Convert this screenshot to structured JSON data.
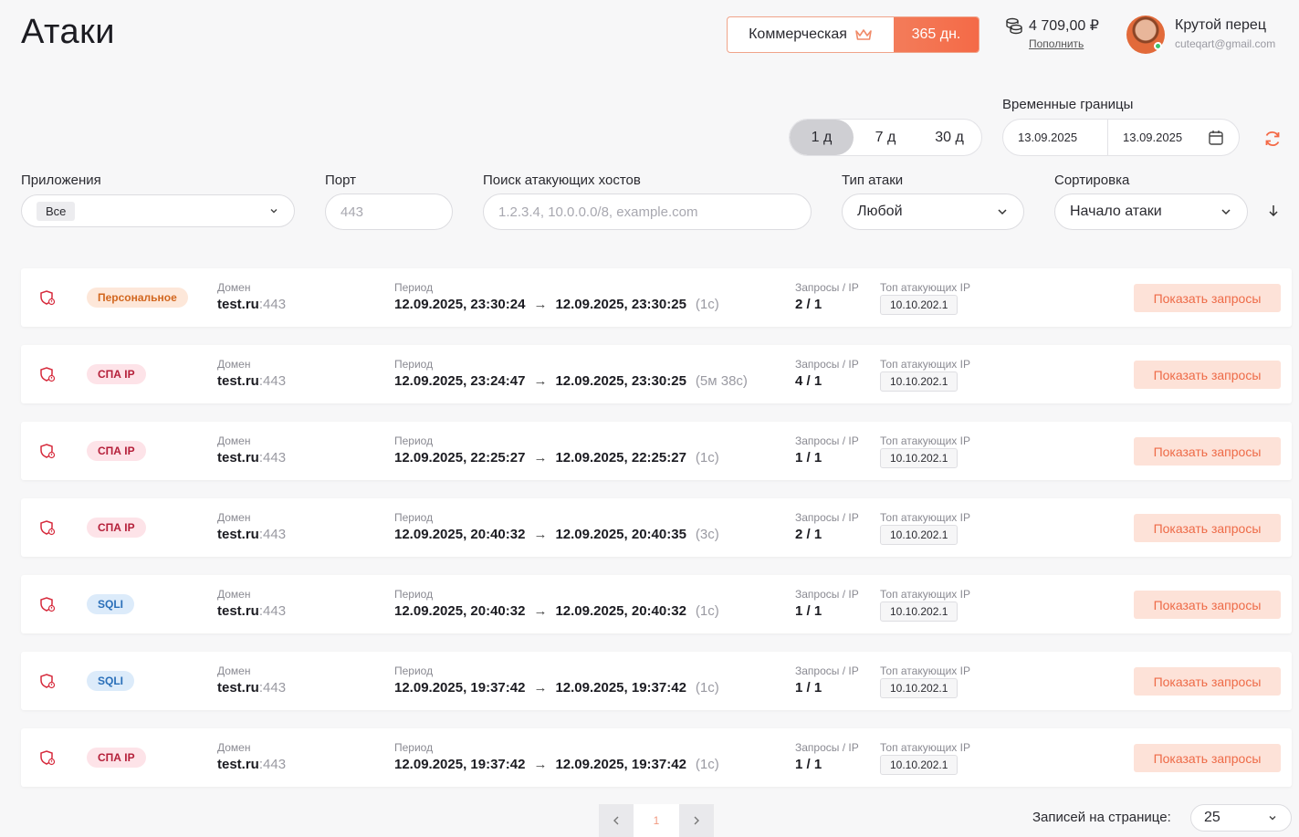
{
  "header": {
    "title": "Атаки",
    "plan_name": "Коммерческая",
    "plan_days": "365 дн.",
    "balance": "4 709,00 ₽",
    "topup_label": "Пополнить",
    "user_name": "Крутой перец",
    "user_email": "cuteqart@gmail.com"
  },
  "time_filter": {
    "label": "Временные границы",
    "periods": [
      "1 д",
      "7 д",
      "30 д"
    ],
    "active_period": "1 д",
    "date_from": "13.09.2025",
    "date_to": "13.09.2025"
  },
  "filters": {
    "apps_label": "Приложения",
    "apps_value": "Все",
    "port_label": "Порт",
    "port_placeholder": "443",
    "search_label": "Поиск атакующих хостов",
    "search_placeholder": "1.2.3.4, 10.0.0.0/8, example.com",
    "attack_type_label": "Тип атаки",
    "attack_type_value": "Любой",
    "sort_label": "Сортировка",
    "sort_value": "Начало атаки"
  },
  "columns": {
    "domain": "Домен",
    "period": "Период",
    "requests_ip": "Запросы / IP",
    "top_ip": "Топ атакующих IP",
    "show_button": "Показать запросы"
  },
  "attacks": [
    {
      "type": "Персональное",
      "type_class": "personal",
      "domain": "test.ru",
      "port": ":443",
      "start": "12.09.2025, 23:30:24",
      "end": "12.09.2025, 23:30:25",
      "duration": "(1с)",
      "requests_ip": "2 / 1",
      "top_ip": "10.10.202.1"
    },
    {
      "type": "СПА IP",
      "type_class": "spa",
      "domain": "test.ru",
      "port": ":443",
      "start": "12.09.2025, 23:24:47",
      "end": "12.09.2025, 23:30:25",
      "duration": "(5м 38с)",
      "requests_ip": "4 / 1",
      "top_ip": "10.10.202.1"
    },
    {
      "type": "СПА IP",
      "type_class": "spa",
      "domain": "test.ru",
      "port": ":443",
      "start": "12.09.2025, 22:25:27",
      "end": "12.09.2025, 22:25:27",
      "duration": "(1с)",
      "requests_ip": "1 / 1",
      "top_ip": "10.10.202.1"
    },
    {
      "type": "СПА IP",
      "type_class": "spa",
      "domain": "test.ru",
      "port": ":443",
      "start": "12.09.2025, 20:40:32",
      "end": "12.09.2025, 20:40:35",
      "duration": "(3с)",
      "requests_ip": "2 / 1",
      "top_ip": "10.10.202.1"
    },
    {
      "type": "SQLI",
      "type_class": "sqli",
      "domain": "test.ru",
      "port": ":443",
      "start": "12.09.2025, 20:40:32",
      "end": "12.09.2025, 20:40:32",
      "duration": "(1с)",
      "requests_ip": "1 / 1",
      "top_ip": "10.10.202.1"
    },
    {
      "type": "SQLI",
      "type_class": "sqli",
      "domain": "test.ru",
      "port": ":443",
      "start": "12.09.2025, 19:37:42",
      "end": "12.09.2025, 19:37:42",
      "duration": "(1с)",
      "requests_ip": "1 / 1",
      "top_ip": "10.10.202.1"
    },
    {
      "type": "СПА IP",
      "type_class": "spa",
      "domain": "test.ru",
      "port": ":443",
      "start": "12.09.2025, 19:37:42",
      "end": "12.09.2025, 19:37:42",
      "duration": "(1с)",
      "requests_ip": "1 / 1",
      "top_ip": "10.10.202.1"
    }
  ],
  "pagination": {
    "current_page": "1",
    "per_page_label": "Записей на странице:",
    "per_page_value": "25"
  },
  "icons": {
    "crown": "crown-icon",
    "coins": "coins-icon",
    "calendar": "calendar-icon",
    "refresh": "refresh-icon",
    "chevron": "chevron-down-icon",
    "sort": "sort-arrow-icon",
    "shield": "shield-alert-icon"
  },
  "colors": {
    "accent": "#f46a47",
    "personal": "#d2671f",
    "spa": "#b5203a",
    "sqli": "#2a6fb9"
  }
}
